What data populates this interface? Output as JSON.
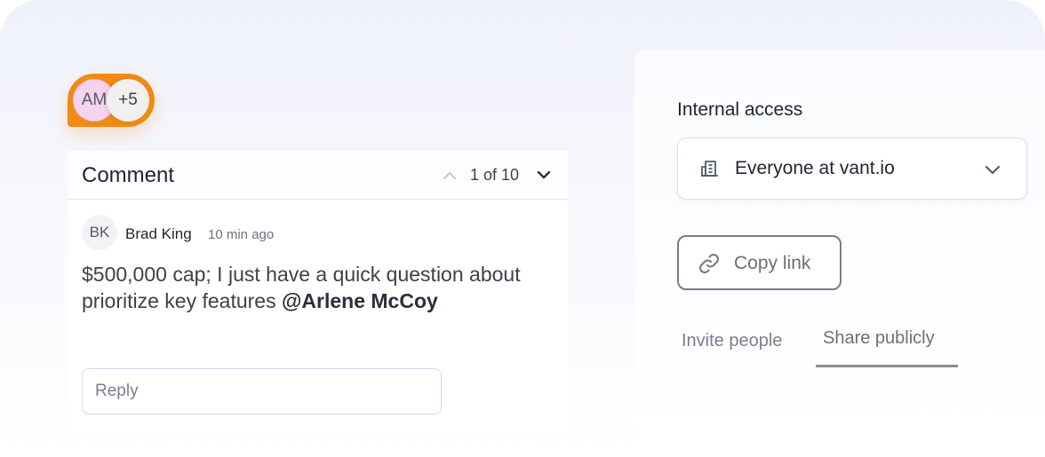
{
  "comment_widget": {
    "participants": [
      {
        "initials": "AM"
      },
      {
        "initials": "+5"
      }
    ],
    "header": {
      "title": "Comment",
      "pager": "1 of 10"
    },
    "comment": {
      "author_initials": "BK",
      "author": "Brad King",
      "time": "10 min ago",
      "text": "$500,000 cap; I just have a quick question about prioritize key features ",
      "mention": "@Arlene McCoy"
    },
    "reply": {
      "placeholder": "Reply",
      "value": ""
    }
  },
  "share_panel": {
    "internal_access_label": "Internal access",
    "access_select": {
      "value": "Everyone at vant.io",
      "icon": "building-icon"
    },
    "copy_link_label": "Copy link",
    "tabs": [
      {
        "label": "Invite people",
        "active": false
      },
      {
        "label": "Share publicly",
        "active": true
      }
    ]
  },
  "colors": {
    "accent_orange": "#f08a12",
    "avatar_pink": "#f5d3ec",
    "text_dark": "#1f2430",
    "text_muted": "#6b6f78"
  }
}
